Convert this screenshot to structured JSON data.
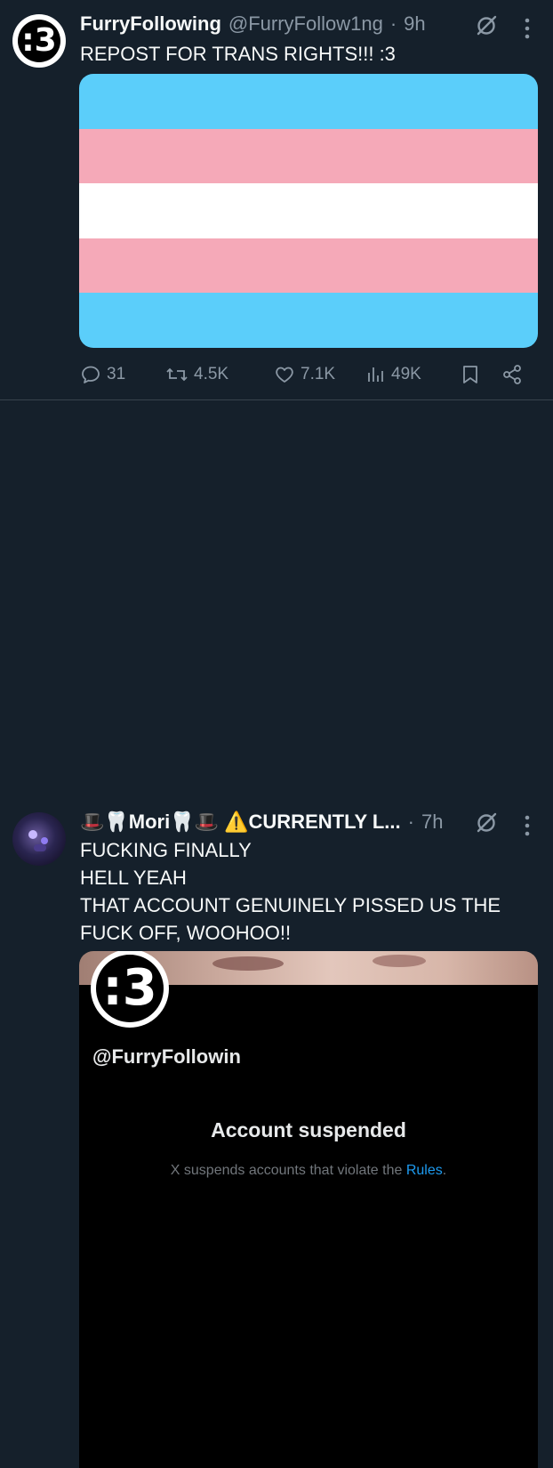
{
  "tweets": [
    {
      "author_name": "FurryFollowing",
      "handle": "@FurryFollow1ng",
      "dot": "·",
      "time": "9h",
      "avatar_text": ":3",
      "text": "REPOST FOR TRANS RIGHTS!!! :3",
      "image": {
        "type": "flag",
        "stripes": [
          "#5bcefa",
          "#f5a9b8",
          "#ffffff",
          "#f5a9b8",
          "#5bcefa"
        ]
      },
      "stats": {
        "replies": "31",
        "reposts": "4.5K",
        "likes": "7.1K",
        "views": "49K"
      }
    },
    {
      "author_name": "🎩🦷Mori🦷🎩 ⚠️CURRENTLY L...",
      "dot": "·",
      "time": "7h",
      "text": "FUCKING FINALLY\nHELL YEAH\nTHAT ACCOUNT GENUINELY PISSED US THE FUCK OFF, WOOHOO!!",
      "embedded_screenshot": {
        "avatar_text": ":3",
        "handle": "@FurryFollowin",
        "title": "Account suspended",
        "description_prefix": "X suspends accounts that violate the ",
        "description_link": "Rules",
        "description_suffix": "."
      }
    }
  ],
  "icons": {
    "grok": "grok-icon",
    "more": "more-vertical-icon",
    "reply": "reply-icon",
    "repost": "repost-icon",
    "like": "heart-icon",
    "views": "views-icon",
    "bookmark": "bookmark-icon",
    "share": "share-icon"
  },
  "colors": {
    "background": "#15202b",
    "secondary_text": "#8b98a5",
    "link": "#1d9bf0",
    "divider": "#38444d"
  }
}
